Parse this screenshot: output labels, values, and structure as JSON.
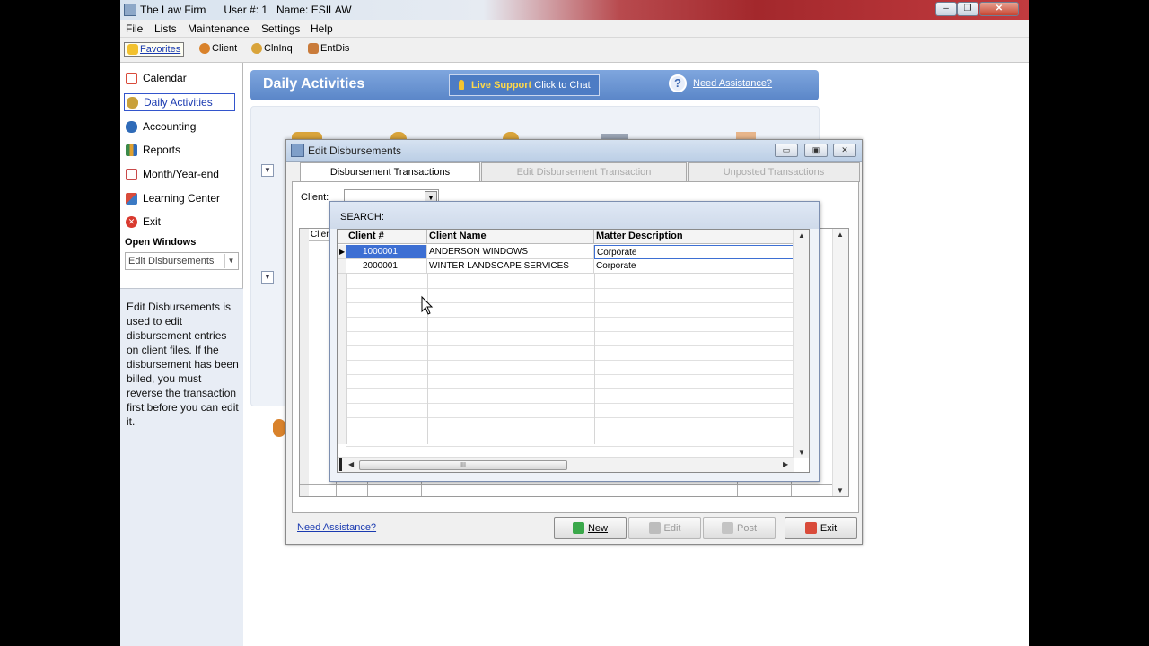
{
  "window": {
    "title": "The Law Firm      User #: 1   Name: ESILAW"
  },
  "menu": [
    "File",
    "Lists",
    "Maintenance",
    "Settings",
    "Help"
  ],
  "toolbar": {
    "favorites": "Favorites",
    "client": "Client",
    "clninq": "ClnInq",
    "entdis": "EntDis"
  },
  "sidebar": {
    "items": [
      {
        "label": "Calendar",
        "icon": "calendar-icon",
        "color": "#d94b3a"
      },
      {
        "label": "Daily Activities",
        "icon": "daily-activities-icon",
        "color": "#c9a13a",
        "selected": true
      },
      {
        "label": "Accounting",
        "icon": "accounting-icon",
        "color": "#2f6bb8"
      },
      {
        "label": "Reports",
        "icon": "reports-icon",
        "color": "#3a8a4a"
      },
      {
        "label": "Month/Year-end",
        "icon": "month-year-end-icon",
        "color": "#c94a4a"
      },
      {
        "label": "Learning Center",
        "icon": "learning-center-icon",
        "color": "#3b7ac4"
      },
      {
        "label": "Exit",
        "icon": "exit-icon",
        "color": "#d93a2f"
      }
    ],
    "open_windows_label": "Open Windows",
    "open_windows_value": "Edit Disbursements",
    "help_text": "Edit Disbursements is used to edit disbursement entries on client files.  If the disbursement has been billed, you must reverse the transaction first before you can edit it."
  },
  "main": {
    "title": "Daily Activities",
    "live_support": {
      "bold": "Live Support",
      "rest": " Click to Chat"
    },
    "need_assistance": "Need Assistance?"
  },
  "dialog": {
    "title": "Edit Disbursements",
    "tabs": [
      "Disbursement Transactions",
      "Edit Disbursement Transaction",
      "Unposted Transactions"
    ],
    "client_label": "Client:",
    "grid_first_header": "Client",
    "need_assistance": "Need Assistance?",
    "buttons": {
      "new": "New",
      "edit": "Edit",
      "post": "Post",
      "exit": "Exit"
    }
  },
  "search": {
    "header": "SEARCH:",
    "columns": [
      "Client #",
      "Client Name",
      "Matter Description"
    ],
    "rows": [
      {
        "client_no": "1000001",
        "client_name": "ANDERSON WINDOWS",
        "matter": "Corporate"
      },
      {
        "client_no": "2000001",
        "client_name": "WINTER LANDSCAPE SERVICES",
        "matter": "Corporate"
      }
    ],
    "scroll_thumb": "III"
  },
  "colors": {
    "accent": "#5a86c8",
    "selection": "#3d6fd3",
    "link": "#1a3ab0"
  }
}
